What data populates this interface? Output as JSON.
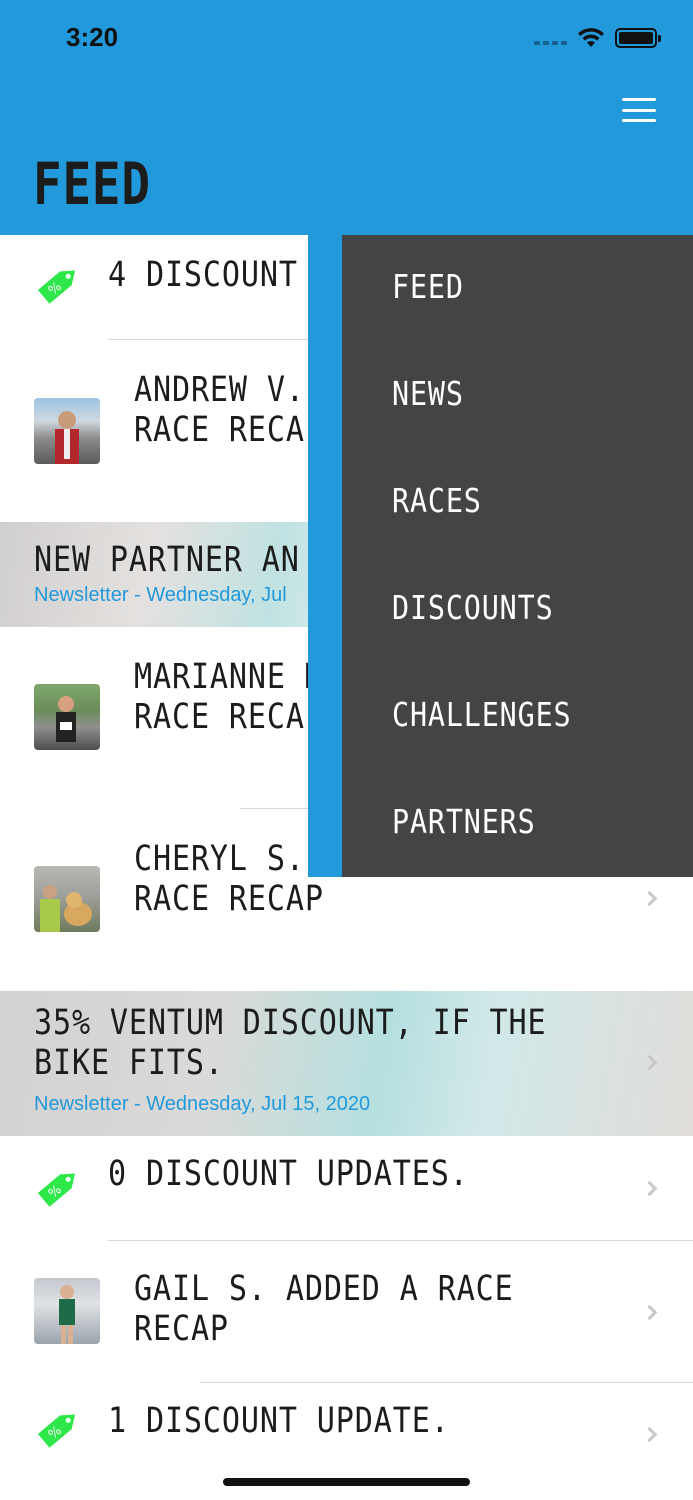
{
  "status_bar": {
    "time": "3:20"
  },
  "header": {
    "title": "FEED",
    "menu_icon": "hamburger-icon"
  },
  "colors": {
    "brand_blue": "#2299db",
    "menu_bg": "#444444",
    "tag_green": "#2ee84a",
    "link_blue": "#2299db"
  },
  "feed": {
    "discount_row_1": {
      "text": "4 DISCOUNT",
      "icon": "discount-tag-icon"
    },
    "andrew_row": {
      "text": "ANDREW V.\nRACE RECA"
    },
    "partner_banner": {
      "title": "NEW PARTNER AN",
      "subtitle": "Newsletter - Wednesday, Jul"
    },
    "marianne_row": {
      "text": "MARIANNE M\nRACE RECA"
    },
    "cheryl_row": {
      "text": "CHERYL S.\nRACE RECAP"
    },
    "ventum_banner": {
      "title": "35% VENTUM DISCOUNT, IF THE\nBIKE FITS.",
      "subtitle": "Newsletter - Wednesday, Jul 15, 2020"
    },
    "discount_row_2": {
      "text": "0 DISCOUNT UPDATES.",
      "icon": "discount-tag-icon"
    },
    "gail_row": {
      "text": "GAIL S. ADDED A RACE RECAP"
    },
    "discount_row_3": {
      "text": "1 DISCOUNT UPDATE.",
      "icon": "discount-tag-icon"
    }
  },
  "menu": {
    "items": [
      {
        "label": "FEED"
      },
      {
        "label": "NEWS"
      },
      {
        "label": "RACES"
      },
      {
        "label": "DISCOUNTS"
      },
      {
        "label": "CHALLENGES"
      },
      {
        "label": "PARTNERS"
      }
    ]
  }
}
